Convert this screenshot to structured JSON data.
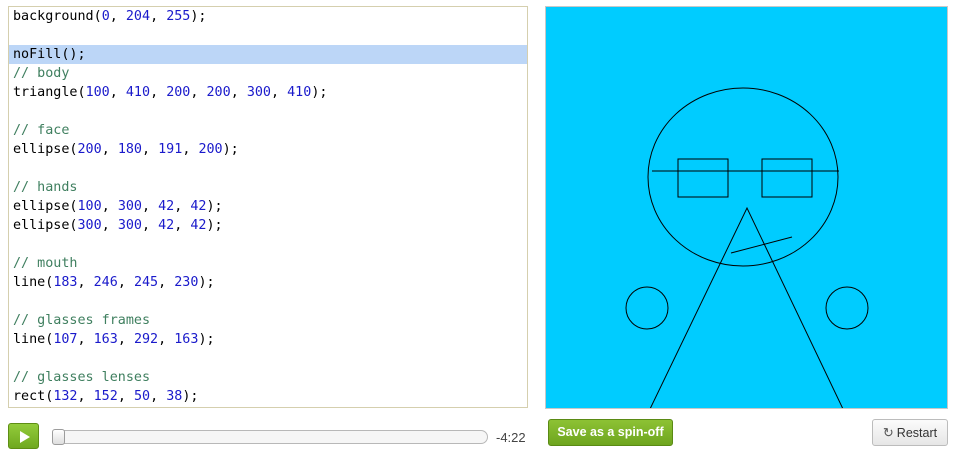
{
  "editor": {
    "lines": [
      {
        "tokens": [
          {
            "t": "background(",
            "k": "plain"
          },
          {
            "t": "0",
            "k": "num"
          },
          {
            "t": ", ",
            "k": "plain"
          },
          {
            "t": "204",
            "k": "num"
          },
          {
            "t": ", ",
            "k": "plain"
          },
          {
            "t": "255",
            "k": "num"
          },
          {
            "t": ");",
            "k": "plain"
          }
        ]
      },
      {
        "tokens": []
      },
      {
        "highlight": true,
        "tokens": [
          {
            "t": "noFill();",
            "k": "plain"
          }
        ]
      },
      {
        "tokens": [
          {
            "t": "// body",
            "k": "comment"
          }
        ]
      },
      {
        "tokens": [
          {
            "t": "triangle(",
            "k": "plain"
          },
          {
            "t": "100",
            "k": "num"
          },
          {
            "t": ", ",
            "k": "plain"
          },
          {
            "t": "410",
            "k": "num"
          },
          {
            "t": ", ",
            "k": "plain"
          },
          {
            "t": "200",
            "k": "num"
          },
          {
            "t": ", ",
            "k": "plain"
          },
          {
            "t": "200",
            "k": "num"
          },
          {
            "t": ", ",
            "k": "plain"
          },
          {
            "t": "300",
            "k": "num"
          },
          {
            "t": ", ",
            "k": "plain"
          },
          {
            "t": "410",
            "k": "num"
          },
          {
            "t": ");",
            "k": "plain"
          }
        ]
      },
      {
        "tokens": []
      },
      {
        "tokens": [
          {
            "t": "// face",
            "k": "comment"
          }
        ]
      },
      {
        "tokens": [
          {
            "t": "ellipse(",
            "k": "plain"
          },
          {
            "t": "200",
            "k": "num"
          },
          {
            "t": ", ",
            "k": "plain"
          },
          {
            "t": "180",
            "k": "num"
          },
          {
            "t": ", ",
            "k": "plain"
          },
          {
            "t": "191",
            "k": "num"
          },
          {
            "t": ", ",
            "k": "plain"
          },
          {
            "t": "200",
            "k": "num"
          },
          {
            "t": ");",
            "k": "plain"
          }
        ]
      },
      {
        "tokens": []
      },
      {
        "tokens": [
          {
            "t": "// hands",
            "k": "comment"
          }
        ]
      },
      {
        "tokens": [
          {
            "t": "ellipse(",
            "k": "plain"
          },
          {
            "t": "100",
            "k": "num"
          },
          {
            "t": ", ",
            "k": "plain"
          },
          {
            "t": "300",
            "k": "num"
          },
          {
            "t": ", ",
            "k": "plain"
          },
          {
            "t": "42",
            "k": "num"
          },
          {
            "t": ", ",
            "k": "plain"
          },
          {
            "t": "42",
            "k": "num"
          },
          {
            "t": ");",
            "k": "plain"
          }
        ]
      },
      {
        "tokens": [
          {
            "t": "ellipse(",
            "k": "plain"
          },
          {
            "t": "300",
            "k": "num"
          },
          {
            "t": ", ",
            "k": "plain"
          },
          {
            "t": "300",
            "k": "num"
          },
          {
            "t": ", ",
            "k": "plain"
          },
          {
            "t": "42",
            "k": "num"
          },
          {
            "t": ", ",
            "k": "plain"
          },
          {
            "t": "42",
            "k": "num"
          },
          {
            "t": ");",
            "k": "plain"
          }
        ]
      },
      {
        "tokens": []
      },
      {
        "tokens": [
          {
            "t": "// mouth",
            "k": "comment"
          }
        ]
      },
      {
        "tokens": [
          {
            "t": "line(",
            "k": "plain"
          },
          {
            "t": "183",
            "k": "num"
          },
          {
            "t": ", ",
            "k": "plain"
          },
          {
            "t": "246",
            "k": "num"
          },
          {
            "t": ", ",
            "k": "plain"
          },
          {
            "t": "245",
            "k": "num"
          },
          {
            "t": ", ",
            "k": "plain"
          },
          {
            "t": "230",
            "k": "num"
          },
          {
            "t": ");",
            "k": "plain"
          }
        ]
      },
      {
        "tokens": []
      },
      {
        "tokens": [
          {
            "t": "// glasses frames",
            "k": "comment"
          }
        ]
      },
      {
        "tokens": [
          {
            "t": "line(",
            "k": "plain"
          },
          {
            "t": "107",
            "k": "num"
          },
          {
            "t": ", ",
            "k": "plain"
          },
          {
            "t": "163",
            "k": "num"
          },
          {
            "t": ", ",
            "k": "plain"
          },
          {
            "t": "292",
            "k": "num"
          },
          {
            "t": ", ",
            "k": "plain"
          },
          {
            "t": "163",
            "k": "num"
          },
          {
            "t": ");",
            "k": "plain"
          }
        ]
      },
      {
        "tokens": []
      },
      {
        "tokens": [
          {
            "t": "// glasses lenses",
            "k": "comment"
          }
        ]
      },
      {
        "tokens": [
          {
            "t": "rect(",
            "k": "plain"
          },
          {
            "t": "132",
            "k": "num"
          },
          {
            "t": ", ",
            "k": "plain"
          },
          {
            "t": "152",
            "k": "num"
          },
          {
            "t": ", ",
            "k": "plain"
          },
          {
            "t": "50",
            "k": "num"
          },
          {
            "t": ", ",
            "k": "plain"
          },
          {
            "t": "38",
            "k": "num"
          },
          {
            "t": ");",
            "k": "plain"
          }
        ]
      }
    ]
  },
  "canvas": {
    "background": "#00ccff",
    "stroke": "#000000"
  },
  "controls": {
    "play_icon": "play-icon",
    "progress": 0,
    "time_remaining": "-4:22",
    "spinoff_label": "Save as a spin-off",
    "restart_icon": "refresh-icon",
    "restart_label": "Restart"
  },
  "colors": {
    "number": "#1a1acb",
    "comment": "#3f7f5f",
    "line_highlight": "#bcd6f7",
    "button_green": "#7cb52a"
  }
}
